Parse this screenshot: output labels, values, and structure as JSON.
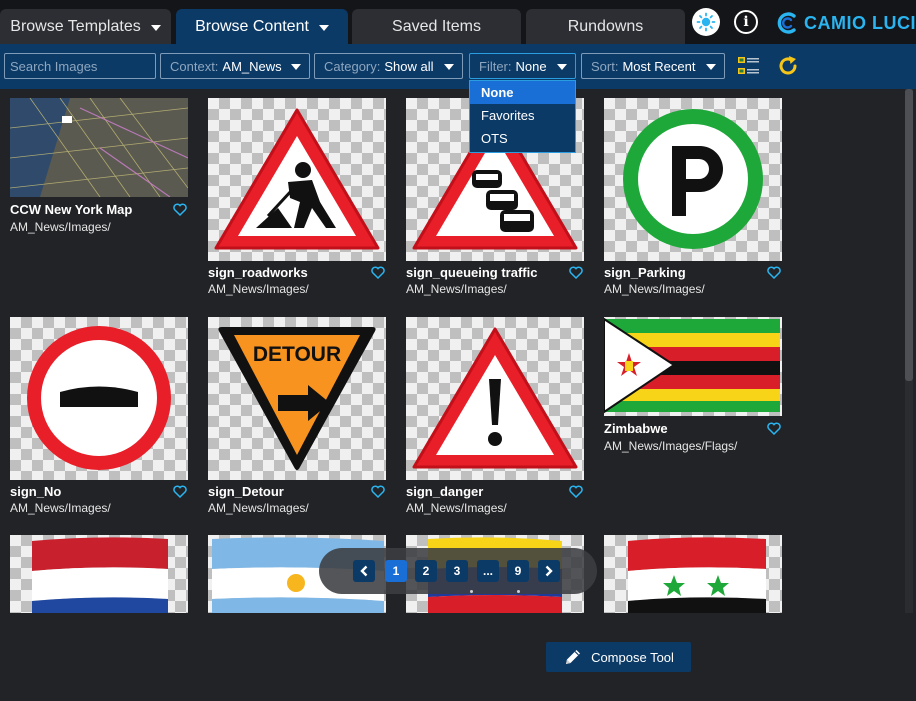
{
  "nav": {
    "tabs": [
      {
        "label": "Browse Templates",
        "active": false,
        "has_menu": true
      },
      {
        "label": "Browse Content",
        "active": true,
        "has_menu": true
      },
      {
        "label": "Saved Items",
        "active": false,
        "has_menu": false
      },
      {
        "label": "Rundowns",
        "active": false,
        "has_menu": false
      }
    ],
    "brand": "CAMIO LUCI",
    "icons": [
      "sun-icon",
      "info-icon",
      "camio-logo"
    ]
  },
  "toolbar": {
    "search_placeholder": "Search Images",
    "context": {
      "label": "Context:",
      "value": "AM_News"
    },
    "category": {
      "label": "Category:",
      "value": "Show all"
    },
    "filter": {
      "label": "Filter:",
      "value": "None",
      "open": true
    },
    "sort": {
      "label": "Sort:",
      "value": "Most Recent"
    },
    "icons": [
      "list-view-icon",
      "refresh-icon"
    ]
  },
  "filter_options": [
    "None",
    "Favorites",
    "OTS"
  ],
  "items": [
    {
      "name": "CCW New York Map",
      "path": "AM_News/Images/"
    },
    {
      "name": "sign_roadworks",
      "path": "AM_News/Images/"
    },
    {
      "name": "sign_queueing traffic",
      "path": "AM_News/Images/"
    },
    {
      "name": "sign_Parking",
      "path": "AM_News/Images/"
    },
    {
      "name": "sign_No",
      "path": "AM_News/Images/"
    },
    {
      "name": "sign_Detour",
      "path": "AM_News/Images/",
      "image_text": "DETOUR"
    },
    {
      "name": "sign_danger",
      "path": "AM_News/Images/"
    },
    {
      "name": "Zimbabwe",
      "path": "AM_News/Images/Flags/"
    },
    {
      "name": "",
      "path": ""
    },
    {
      "name": "",
      "path": ""
    },
    {
      "name": "",
      "path": ""
    },
    {
      "name": "",
      "path": ""
    }
  ],
  "pagination": {
    "pages": [
      "1",
      "2",
      "3",
      "...",
      "9"
    ],
    "current": "1"
  },
  "compose": {
    "label": "Compose Tool"
  },
  "colors": {
    "toolbar": "#0c3a66",
    "accent": "#2ab4f0",
    "selected": "#1a6fd6",
    "favorite": "#2ab4f0",
    "refresh": "#f5c518"
  }
}
